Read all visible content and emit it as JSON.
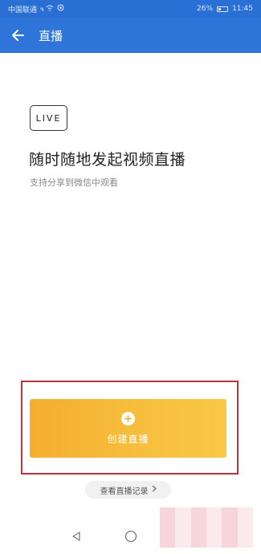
{
  "status_bar": {
    "carrier": "中国联通",
    "signal": "ᵃᵢₗₗ",
    "battery_pct": "26%",
    "time": "11:45"
  },
  "app_bar": {
    "title": "直播",
    "back_icon": "arrow-left-icon"
  },
  "main": {
    "badge": "LIVE",
    "headline": "随时随地发起视频直播",
    "subline": "支持分享到微信中观看",
    "create_button": {
      "label": "创建直播",
      "icon": "plus-circle-icon"
    },
    "history_link": {
      "label": "查看直播记录",
      "icon": "chevron-right-icon"
    }
  },
  "nav_bar": {
    "back": "triangle-back-icon",
    "home": "circle-home-icon"
  },
  "colors": {
    "primary": "#2f74d8",
    "button": "#f7b937",
    "highlight_frame": "#b8353b"
  }
}
